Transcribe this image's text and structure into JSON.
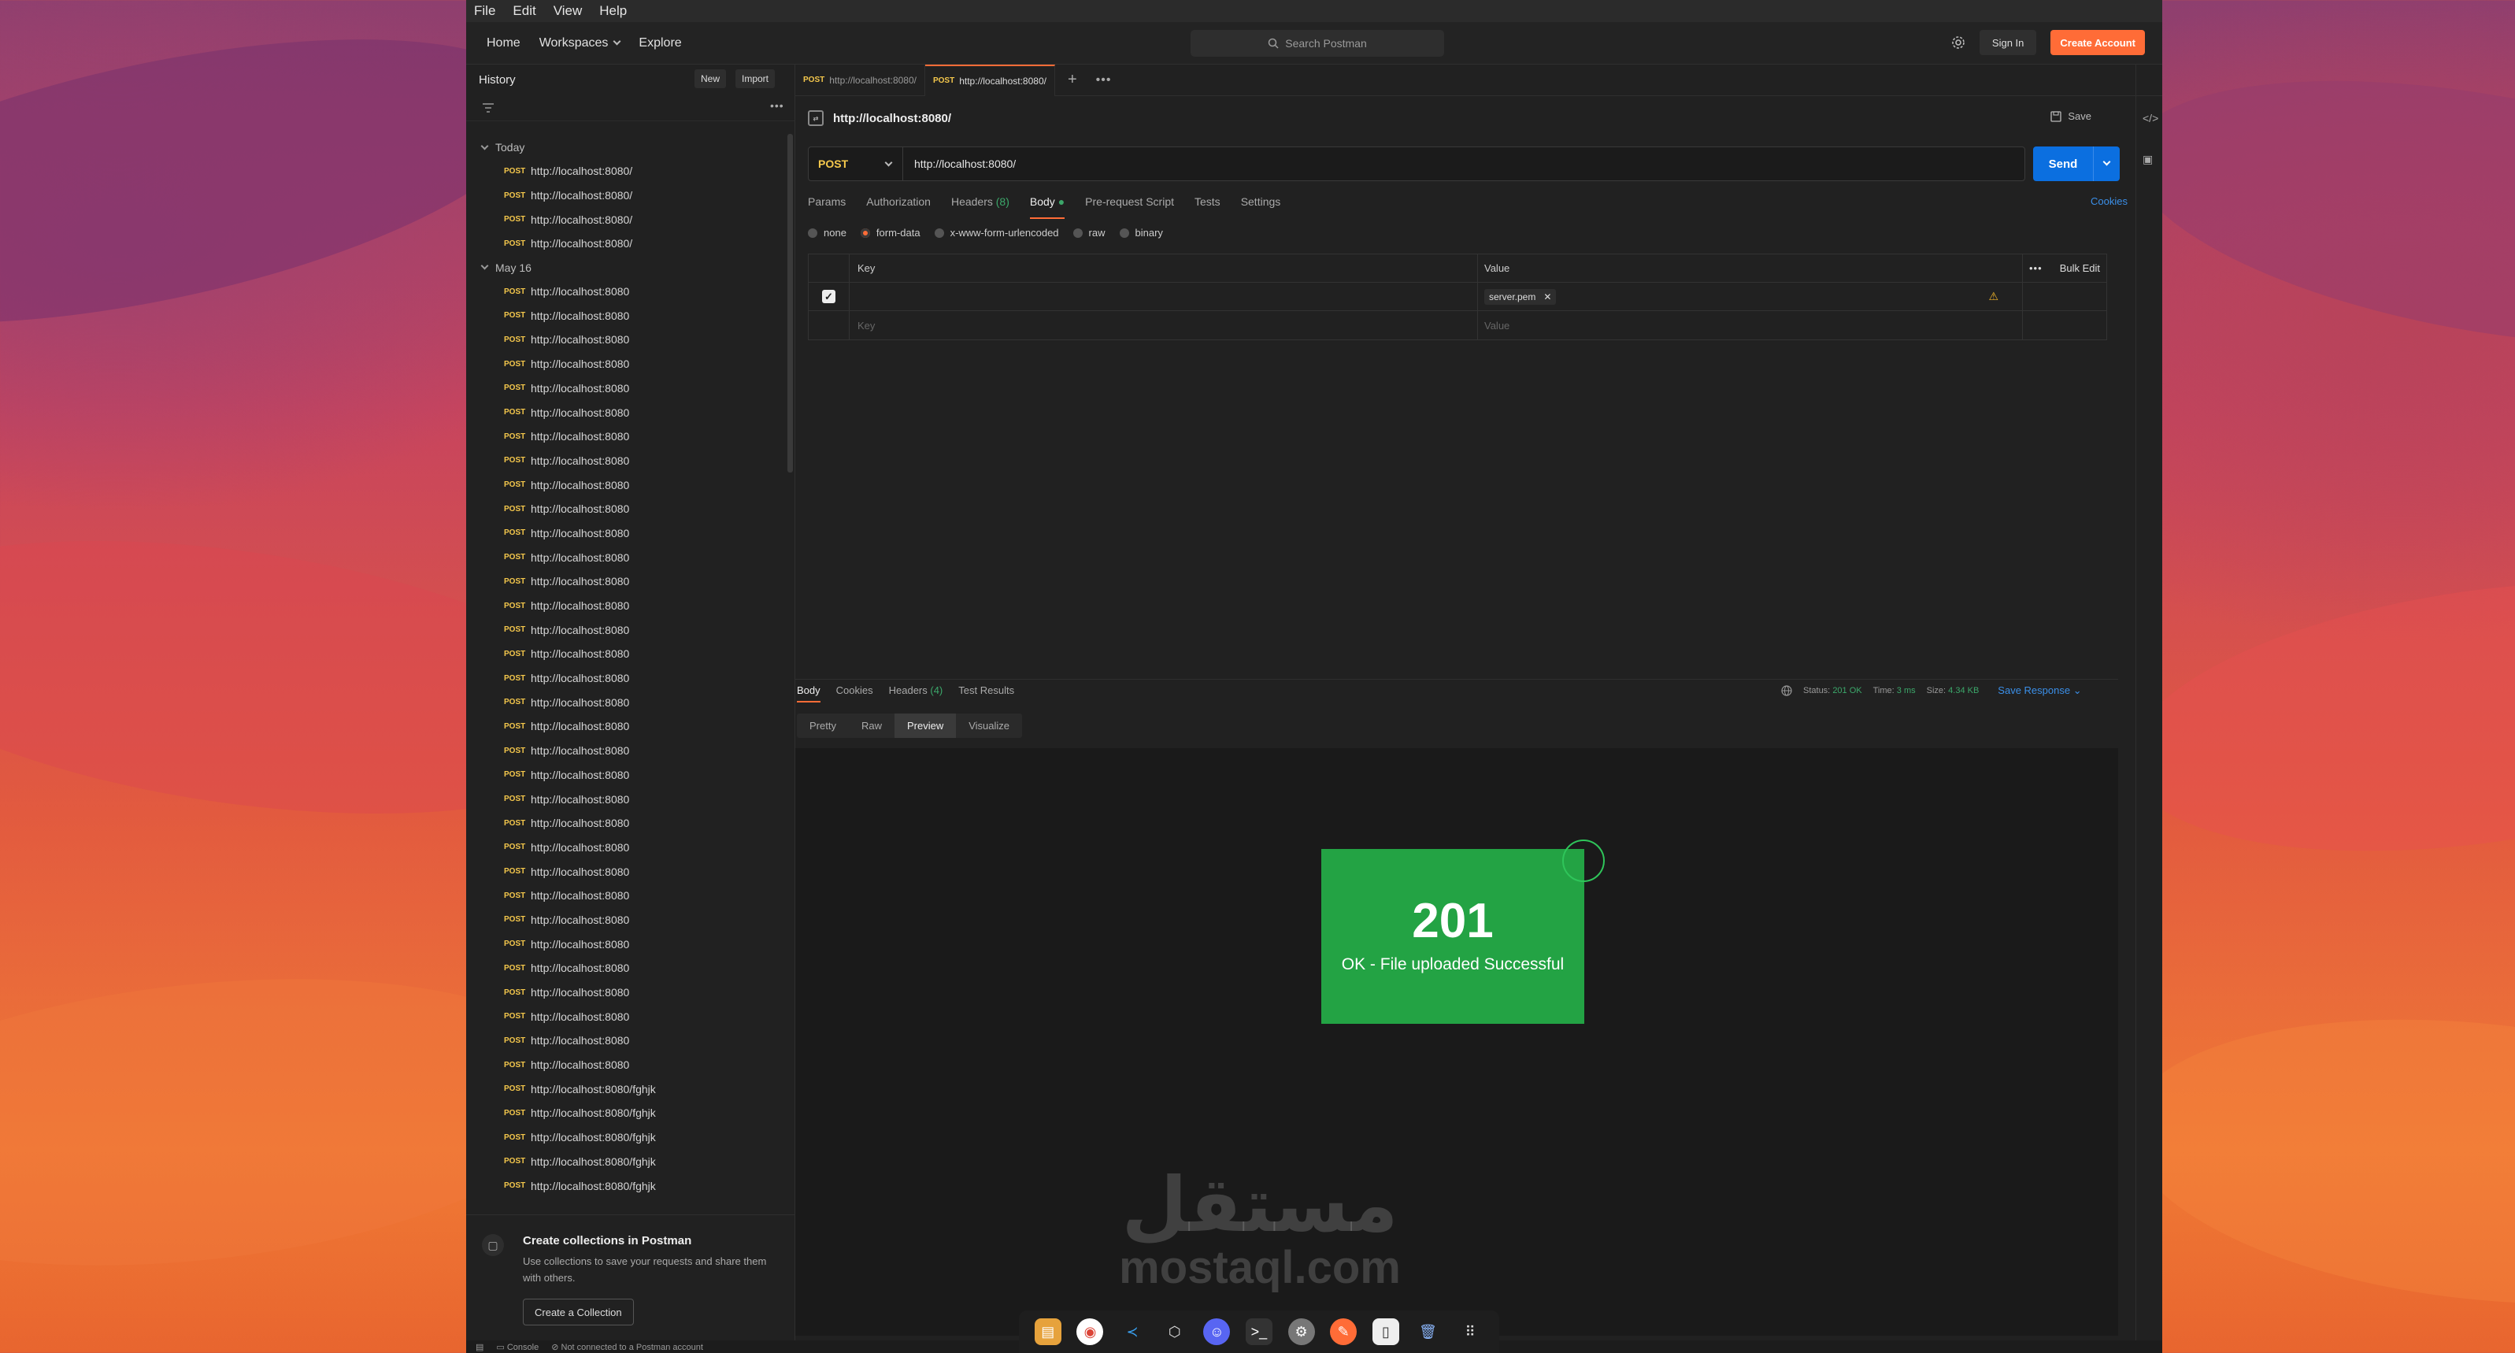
{
  "menubar": [
    "File",
    "Edit",
    "View",
    "Help"
  ],
  "topnav": {
    "home": "Home",
    "workspaces": "Workspaces",
    "explore": "Explore",
    "search_placeholder": "Search Postman",
    "signin": "Sign In",
    "create_account": "Create Account"
  },
  "sidebar": {
    "title": "History",
    "new_btn": "New",
    "import_btn": "Import",
    "groups": [
      {
        "label": "Today",
        "items": [
          {
            "method": "POST",
            "url": "http://localhost:8080/"
          },
          {
            "method": "POST",
            "url": "http://localhost:8080/"
          },
          {
            "method": "POST",
            "url": "http://localhost:8080/"
          },
          {
            "method": "POST",
            "url": "http://localhost:8080/"
          }
        ]
      },
      {
        "label": "May 16",
        "items": [
          {
            "method": "POST",
            "url": "http://localhost:8080"
          },
          {
            "method": "POST",
            "url": "http://localhost:8080"
          },
          {
            "method": "POST",
            "url": "http://localhost:8080"
          },
          {
            "method": "POST",
            "url": "http://localhost:8080"
          },
          {
            "method": "POST",
            "url": "http://localhost:8080"
          },
          {
            "method": "POST",
            "url": "http://localhost:8080"
          },
          {
            "method": "POST",
            "url": "http://localhost:8080"
          },
          {
            "method": "POST",
            "url": "http://localhost:8080"
          },
          {
            "method": "POST",
            "url": "http://localhost:8080"
          },
          {
            "method": "POST",
            "url": "http://localhost:8080"
          },
          {
            "method": "POST",
            "url": "http://localhost:8080"
          },
          {
            "method": "POST",
            "url": "http://localhost:8080"
          },
          {
            "method": "POST",
            "url": "http://localhost:8080"
          },
          {
            "method": "POST",
            "url": "http://localhost:8080"
          },
          {
            "method": "POST",
            "url": "http://localhost:8080"
          },
          {
            "method": "POST",
            "url": "http://localhost:8080"
          },
          {
            "method": "POST",
            "url": "http://localhost:8080"
          },
          {
            "method": "POST",
            "url": "http://localhost:8080"
          },
          {
            "method": "POST",
            "url": "http://localhost:8080"
          },
          {
            "method": "POST",
            "url": "http://localhost:8080"
          },
          {
            "method": "POST",
            "url": "http://localhost:8080"
          },
          {
            "method": "POST",
            "url": "http://localhost:8080"
          },
          {
            "method": "POST",
            "url": "http://localhost:8080"
          },
          {
            "method": "POST",
            "url": "http://localhost:8080"
          },
          {
            "method": "POST",
            "url": "http://localhost:8080"
          },
          {
            "method": "POST",
            "url": "http://localhost:8080"
          },
          {
            "method": "POST",
            "url": "http://localhost:8080"
          },
          {
            "method": "POST",
            "url": "http://localhost:8080"
          },
          {
            "method": "POST",
            "url": "http://localhost:8080"
          },
          {
            "method": "POST",
            "url": "http://localhost:8080"
          },
          {
            "method": "POST",
            "url": "http://localhost:8080"
          },
          {
            "method": "POST",
            "url": "http://localhost:8080"
          },
          {
            "method": "POST",
            "url": "http://localhost:8080"
          },
          {
            "method": "POST",
            "url": "http://localhost:8080/fghjk"
          },
          {
            "method": "POST",
            "url": "http://localhost:8080/fghjk"
          },
          {
            "method": "POST",
            "url": "http://localhost:8080/fghjk"
          },
          {
            "method": "POST",
            "url": "http://localhost:8080/fghjk"
          },
          {
            "method": "POST",
            "url": "http://localhost:8080/fghjk"
          }
        ]
      }
    ],
    "promo": {
      "title": "Create collections in Postman",
      "text": "Use collections to save your requests and share them with others.",
      "button": "Create a Collection"
    }
  },
  "tabs": [
    {
      "method": "POST",
      "url": "http://localhost:8080/",
      "active": false
    },
    {
      "method": "POST",
      "url": "http://localhost:8080/",
      "active": true
    }
  ],
  "request": {
    "title": "http://localhost:8080/",
    "save": "Save",
    "method": "POST",
    "url": "http://localhost:8080/",
    "send": "Send",
    "subtabs": {
      "params": "Params",
      "authorization": "Authorization",
      "headers": "Headers",
      "headers_count": "(8)",
      "body": "Body",
      "pre_request": "Pre-request Script",
      "tests": "Tests",
      "settings": "Settings"
    },
    "cookies": "Cookies",
    "body_types": [
      "none",
      "form-data",
      "x-www-form-urlencoded",
      "raw",
      "binary"
    ],
    "selected_body_type": "form-data",
    "table": {
      "key_header": "Key",
      "value_header": "Value",
      "bulk_edit": "Bulk Edit",
      "file_value": "server.pem",
      "key_placeholder": "Key",
      "value_placeholder": "Value"
    }
  },
  "response": {
    "tabs": {
      "body": "Body",
      "cookies": "Cookies",
      "headers": "Headers",
      "headers_count": "(4)",
      "test_results": "Test Results"
    },
    "status_label": "Status:",
    "status_value": "201 OK",
    "time_label": "Time:",
    "time_value": "3 ms",
    "size_label": "Size:",
    "size_value": "4.34 KB",
    "save_response": "Save Response",
    "view_tabs": [
      "Pretty",
      "Raw",
      "Preview",
      "Visualize"
    ],
    "active_view": "Preview",
    "preview_code": "201",
    "preview_message": "OK - File uploaded Successful"
  },
  "statusbar": {
    "console": "Console",
    "connection": "Not connected to a Postman account"
  },
  "watermark": {
    "arabic": "مستقل",
    "latin": "mostaql.com"
  },
  "colors": {
    "accent": "#ff6c37",
    "send_button": "#0b6fe0",
    "method_post": "#f5c84c",
    "status_ok": "#3ca76a",
    "preview_card": "#23a344"
  }
}
